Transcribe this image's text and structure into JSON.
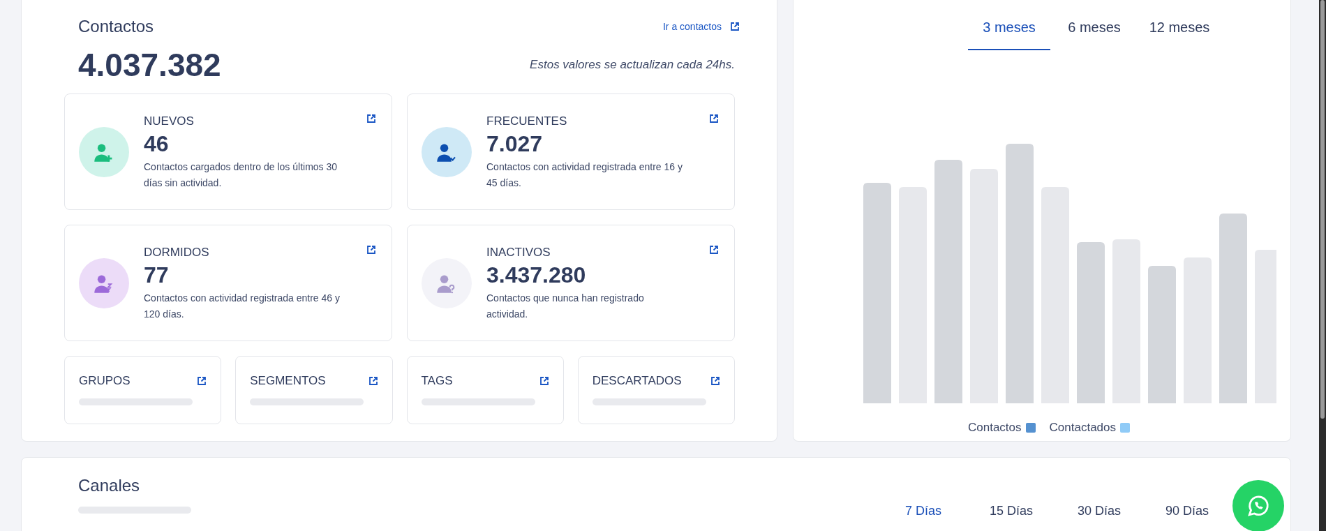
{
  "contacts": {
    "title": "Contactos",
    "link": "Ir a contactos",
    "total": "4.037.382",
    "note": "Estos valores se actualizan cada 24hs.",
    "cards": [
      {
        "kind": "new",
        "title": "NUEVOS",
        "value": "46",
        "description": "Contactos cargados dentro de los últimos 30 días sin actividad."
      },
      {
        "kind": "frequent",
        "title": "FRECUENTES",
        "value": "7.027",
        "description": "Contactos con actividad registrada entre 16 y 45 días."
      },
      {
        "kind": "sleeping",
        "title": "DORMIDOS",
        "value": "77",
        "description": "Contactos con actividad registrada entre 46 y 120 días."
      },
      {
        "kind": "inactive",
        "title": "INACTIVOS",
        "value": "3.437.280",
        "description": "Contactos que nunca han registrado actividad."
      }
    ],
    "mini_cards": [
      {
        "title": "GRUPOS"
      },
      {
        "title": "SEGMENTOS"
      },
      {
        "title": "TAGS"
      },
      {
        "title": "DESCARTADOS"
      }
    ]
  },
  "history": {
    "tabs": [
      {
        "label": "3 meses",
        "selected": true
      },
      {
        "label": "6 meses",
        "selected": false
      },
      {
        "label": "12 meses",
        "selected": false
      }
    ],
    "legend": [
      {
        "label": "Contactos",
        "color": "#5591d0"
      },
      {
        "label": "Contactados",
        "color": "#90cbf7"
      }
    ]
  },
  "channels": {
    "title": "Canales",
    "tabs": [
      {
        "label": "7 Días",
        "selected": true
      },
      {
        "label": "15 Días",
        "selected": false
      },
      {
        "label": "30 Días",
        "selected": false
      },
      {
        "label": "90 Días",
        "selected": false
      }
    ]
  }
}
